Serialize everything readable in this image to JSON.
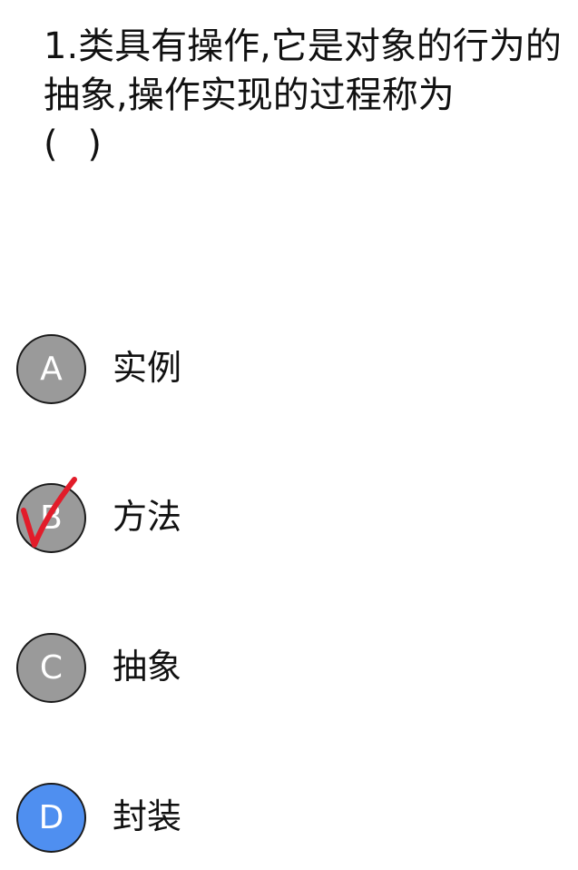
{
  "question": {
    "text": "1.类具有操作,它是对象的行为的抽象,操作实现的过程称为",
    "blank": "(    )"
  },
  "options": [
    {
      "letter": "A",
      "text": "实例",
      "state": "normal"
    },
    {
      "letter": "B",
      "text": "方法",
      "state": "marked-correct"
    },
    {
      "letter": "C",
      "text": "抽象",
      "state": "normal"
    },
    {
      "letter": "D",
      "text": "封装",
      "state": "selected"
    }
  ],
  "colors": {
    "option_default": "#9a9a9a",
    "option_selected": "#4f8ff0",
    "checkmark": "#e21c2a"
  },
  "icons": {
    "correct_mark": "red-checkmark-icon"
  }
}
